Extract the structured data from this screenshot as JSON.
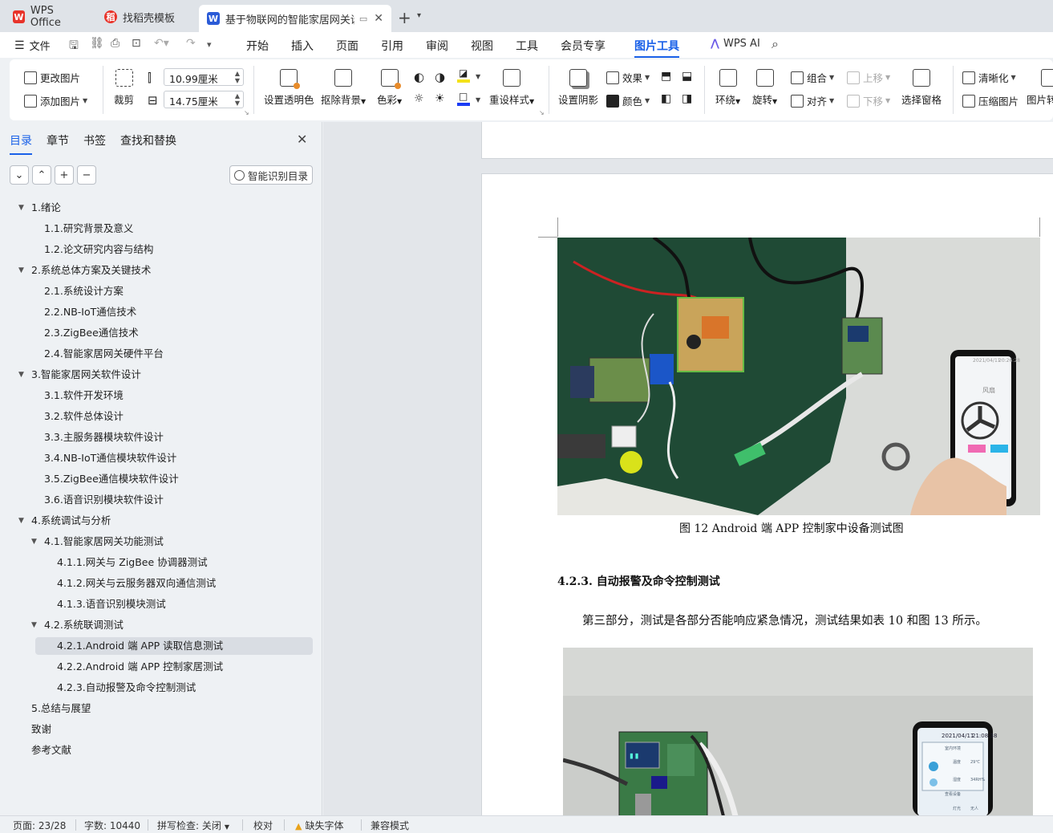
{
  "tabs": [
    {
      "label": "WPS Office",
      "icon": "wps-logo-icon",
      "color": "#e8332a"
    },
    {
      "label": "找稻壳模板",
      "icon": "daoke-logo-icon",
      "color": "#e8332a"
    },
    {
      "label": "基于物联网的智能家居网关设计",
      "icon": "word-doc-icon",
      "color": "#2b5bd7",
      "active": true
    }
  ],
  "menu": {
    "file_label": "文件",
    "items": [
      "开始",
      "插入",
      "页面",
      "引用",
      "审阅",
      "视图",
      "工具",
      "会员专享",
      "图片工具"
    ],
    "active_item": "图片工具",
    "wps_ai_label": "WPS AI"
  },
  "ribbon": {
    "change_image": "更改图片",
    "add_image": "添加图片",
    "crop": "裁剪",
    "width_value": "10.99厘米",
    "height_value": "14.75厘米",
    "set_transparent": "设置透明色",
    "remove_bg": "抠除背景",
    "color_tone": "色彩",
    "preset_style": "重设样式",
    "set_shadow": "设置阴影",
    "effect": "效果",
    "color": "颜色",
    "wrap": "环绕",
    "rotate": "旋转",
    "group": "组合",
    "align": "对齐",
    "bring_forward": "上移",
    "send_backward": "下移",
    "select_pane": "选择窗格",
    "sharpen": "清晰化",
    "compress": "压缩图片",
    "image_convert": "图片转"
  },
  "nav": {
    "tabs": [
      "目录",
      "章节",
      "书签",
      "查找和替换"
    ],
    "active_tab": "目录",
    "smart_toc": "智能识别目录",
    "toc": [
      {
        "label": "1.绪论",
        "level": 1,
        "expanded": true
      },
      {
        "label": "1.1.研究背景及意义",
        "level": 2
      },
      {
        "label": "1.2.论文研究内容与结构",
        "level": 2
      },
      {
        "label": "2.系统总体方案及关键技术",
        "level": 1,
        "expanded": true
      },
      {
        "label": "2.1.系统设计方案",
        "level": 2
      },
      {
        "label": "2.2.NB-IoT通信技术",
        "level": 2
      },
      {
        "label": "2.3.ZigBee通信技术",
        "level": 2
      },
      {
        "label": "2.4.智能家居网关硬件平台",
        "level": 2
      },
      {
        "label": "3.智能家居网关软件设计",
        "level": 1,
        "expanded": true
      },
      {
        "label": "3.1.软件开发环境",
        "level": 2
      },
      {
        "label": "3.2.软件总体设计",
        "level": 2
      },
      {
        "label": "3.3.主服务器模块软件设计",
        "level": 2
      },
      {
        "label": "3.4.NB-IoT通信模块软件设计",
        "level": 2
      },
      {
        "label": "3.5.ZigBee通信模块软件设计",
        "level": 2
      },
      {
        "label": "3.6.语音识别模块软件设计",
        "level": 2
      },
      {
        "label": "4.系统调试与分析",
        "level": 1,
        "expanded": true
      },
      {
        "label": "4.1.智能家居网关功能测试",
        "level": 2,
        "expanded": true
      },
      {
        "label": "4.1.1.网关与 ZigBee 协调器测试",
        "level": 3
      },
      {
        "label": "4.1.2.网关与云服务器双向通信测试",
        "level": 3
      },
      {
        "label": "4.1.3.语音识别模块测试",
        "level": 3
      },
      {
        "label": "4.2.系统联调测试",
        "level": 2,
        "expanded": true
      },
      {
        "label": "4.2.1.Android 端 APP 读取信息测试",
        "level": 3,
        "selected": true
      },
      {
        "label": "4.2.2.Android 端 APP 控制家居测试",
        "level": 3
      },
      {
        "label": "4.2.3.自动报警及命令控制测试",
        "level": 3
      },
      {
        "label": "5.总结与展望",
        "level": 1
      },
      {
        "label": "致谢",
        "level": 1
      },
      {
        "label": "参考文献",
        "level": 1
      }
    ]
  },
  "document": {
    "figure_caption": "图 12 Android 端 APP 控制家中设备测试图",
    "section_heading": "4.2.3.  自动报警及命令控制测试",
    "paragraph": "第三部分，测试是各部分否能响应紧急情况，测试结果如表 10 和图 13 所示。",
    "phone1_date": "2021/04/11",
    "phone1_time": "20:26:28",
    "phone1_title": "风扇",
    "phone2_date": "2021/04/11",
    "phone2_time": "21:08:38",
    "phone2_env": "室内环境",
    "phone2_temp_label": "温度",
    "phone2_temp": "29℃",
    "phone2_hum_label": "湿度",
    "phone2_hum": "34RH%",
    "phone2_status": "查看设备",
    "phone2_light_label": "灯光",
    "phone2_light": "无人"
  },
  "status": {
    "page": "页面: 23/28",
    "words": "字数: 10440",
    "spell": "拼写检查: 关闭",
    "proof": "校对",
    "missing_font": "缺失字体",
    "compat": "兼容模式"
  }
}
